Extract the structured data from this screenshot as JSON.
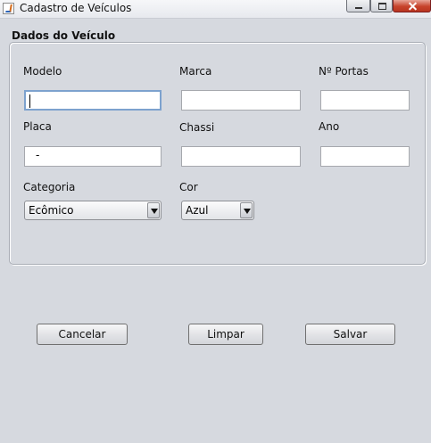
{
  "window": {
    "title": "Cadastro de Veículos"
  },
  "group": {
    "title": "Dados do Veículo"
  },
  "labels": {
    "modelo": "Modelo",
    "marca": "Marca",
    "portas": "Nº Portas",
    "placa": "Placa",
    "chassi": "Chassi",
    "ano": "Ano",
    "categoria": "Categoria",
    "cor": "Cor"
  },
  "fields": {
    "modelo": "",
    "marca": "",
    "portas": "",
    "placa": "-",
    "chassi": "",
    "ano": ""
  },
  "combos": {
    "categoria": "Ecômico",
    "cor": "Azul"
  },
  "buttons": {
    "cancel": "Cancelar",
    "clear": "Limpar",
    "save": "Salvar"
  }
}
